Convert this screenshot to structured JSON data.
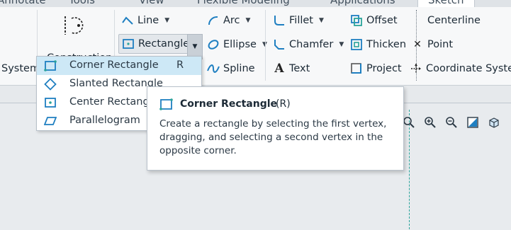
{
  "tabs": [
    "Annotate",
    "Tools",
    "View",
    "Flexible Modeling",
    "Applications",
    "Sketch"
  ],
  "ribbon": {
    "system_label": "System",
    "construction_label": "Construction",
    "buttons": {
      "line": "Line",
      "rectangle": "Rectangle",
      "arc": "Arc",
      "ellipse": "Ellipse",
      "spline": "Spline",
      "fillet": "Fillet",
      "chamfer": "Chamfer",
      "text": "Text",
      "offset": "Offset",
      "thicken": "Thicken",
      "project": "Project",
      "centerline": "Centerline",
      "point": "Point",
      "coordinate_system": "Coordinate System"
    }
  },
  "rectangle_menu": [
    {
      "label": "Corner Rectangle",
      "key": "R",
      "icon": "corner-rectangle-icon"
    },
    {
      "label": "Slanted Rectangle",
      "key": "",
      "icon": "slanted-rectangle-icon"
    },
    {
      "label": "Center Rectangle",
      "key": "",
      "icon": "center-rectangle-icon"
    },
    {
      "label": "Parallelogram",
      "key": "",
      "icon": "parallelogram-icon"
    }
  ],
  "tooltip": {
    "title": "Corner Rectangle",
    "shortcut": "(R)",
    "description": "Create a rectangle by selecting the first vertex, dragging, and selecting a second vertex in the opposite corner."
  },
  "colors": {
    "icon_blue": "#1f7fc1",
    "icon_teal": "#2aa39a",
    "menu_highlight": "#cde8f6"
  }
}
